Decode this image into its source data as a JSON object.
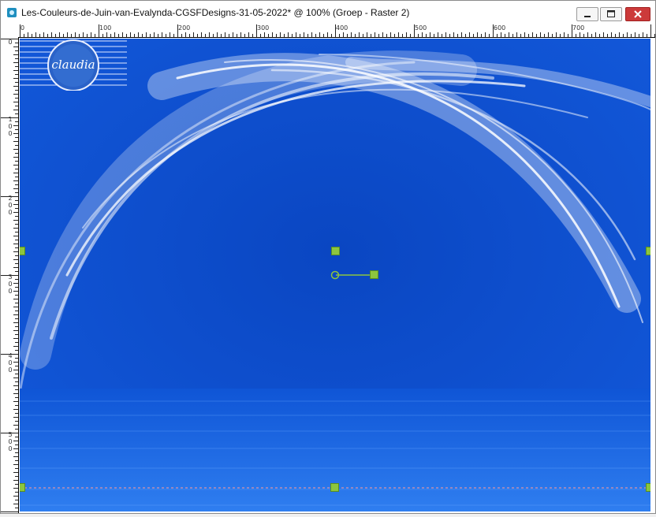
{
  "window": {
    "title": "Les-Couleurs-de-Juin-van-Evalynda-CGSFDesigns-31-05-2022* @ 100% (Groep - Raster 2)"
  },
  "ruler": {
    "top_labels": [
      "0",
      "100",
      "200",
      "300",
      "400",
      "500",
      "600",
      "700"
    ],
    "left_labels": [
      "0",
      "100",
      "200",
      "300",
      "400",
      "500"
    ]
  },
  "canvas": {
    "background_color": "#0a47c4",
    "sea_color": "#0e5be0",
    "handle_color": "#8cc63f",
    "watermark_text": "claudia"
  },
  "icons": {
    "app": "psp-app-icon",
    "minimize": "minimize-icon",
    "maximize": "maximize-icon",
    "close": "close-icon"
  }
}
